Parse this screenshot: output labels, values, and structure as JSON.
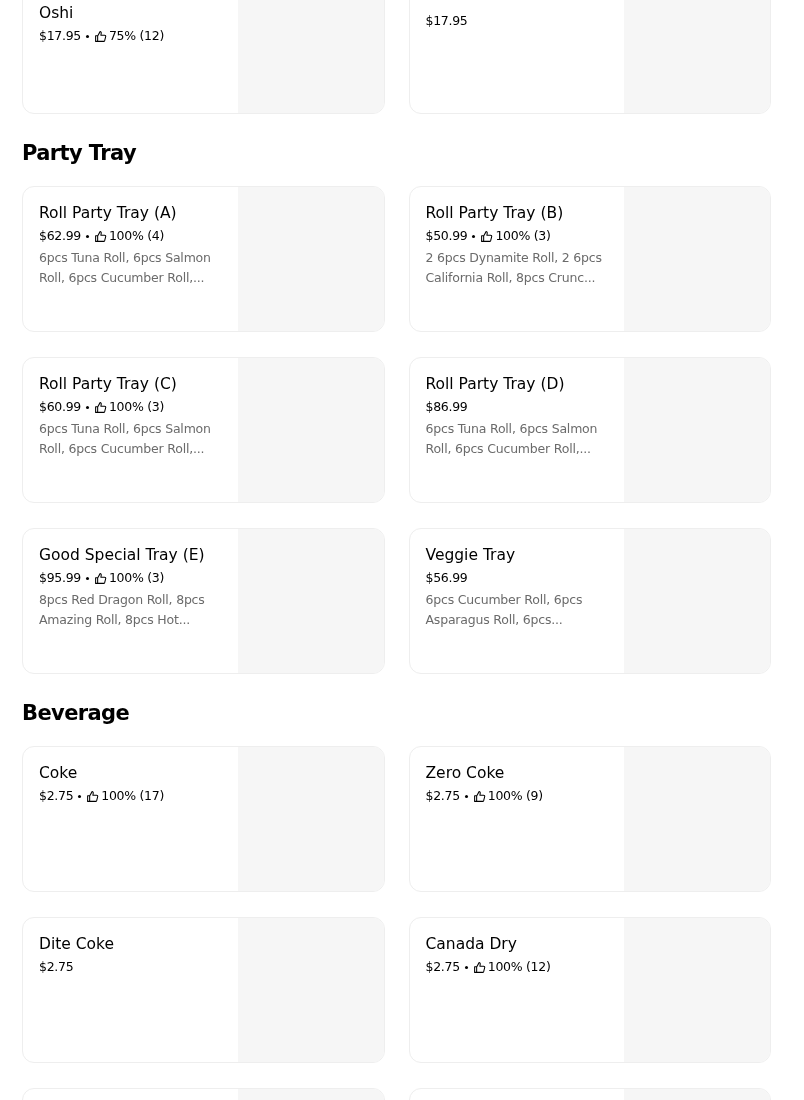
{
  "sections": [
    {
      "items": [
        {
          "kind": "item",
          "title": "Oshi",
          "price": "$17.95",
          "rating": "75% (12)"
        },
        {
          "kind": "item",
          "price": "$17.95"
        }
      ]
    },
    {
      "heading": "Party Tray",
      "items": [
        {
          "kind": "item",
          "title": "Roll Party Tray (A)",
          "price": "$62.99",
          "rating": "100% (4)",
          "description": "6pcs Tuna Roll, 6pcs Salmon Roll, 6pcs Cucumber Roll,..."
        },
        {
          "kind": "item",
          "title": "Roll Party Tray (B)",
          "price": "$50.99",
          "rating": "100% (3)",
          "description": "2 6pcs Dynamite Roll, 2 6pcs California Roll, 8pcs Crunc..."
        },
        {
          "kind": "item",
          "title": "Roll Party Tray (C)",
          "price": "$60.99",
          "rating": "100% (3)",
          "description": "6pcs Tuna Roll, 6pcs Salmon Roll, 6pcs Cucumber Roll,..."
        },
        {
          "kind": "item",
          "title": "Roll Party Tray (D)",
          "price": "$86.99",
          "description": "6pcs Tuna Roll, 6pcs Salmon Roll, 6pcs Cucumber Roll,..."
        },
        {
          "kind": "item",
          "title": "Good Special Tray (E)",
          "price": "$95.99",
          "rating": "100% (3)",
          "description": "8pcs Red Dragon Roll, 8pcs Amazing Roll, 8pcs Hot..."
        },
        {
          "kind": "item",
          "title": "Veggie Tray",
          "price": "$56.99",
          "description": "6pcs Cucumber Roll, 6pcs Asparagus Roll, 6pcs..."
        }
      ]
    },
    {
      "heading": "Beverage",
      "items": [
        {
          "kind": "item",
          "title": "Coke",
          "price": "$2.75",
          "rating": "100% (17)"
        },
        {
          "kind": "item",
          "title": "Zero Coke",
          "price": "$2.75",
          "rating": "100% (9)"
        },
        {
          "kind": "item",
          "title": "Dite Coke",
          "price": "$2.75"
        },
        {
          "kind": "item",
          "title": "Canada Dry",
          "price": "$2.75",
          "rating": "100% (12)"
        },
        {
          "kind": "clipped"
        },
        {
          "kind": "clipped"
        }
      ]
    }
  ]
}
